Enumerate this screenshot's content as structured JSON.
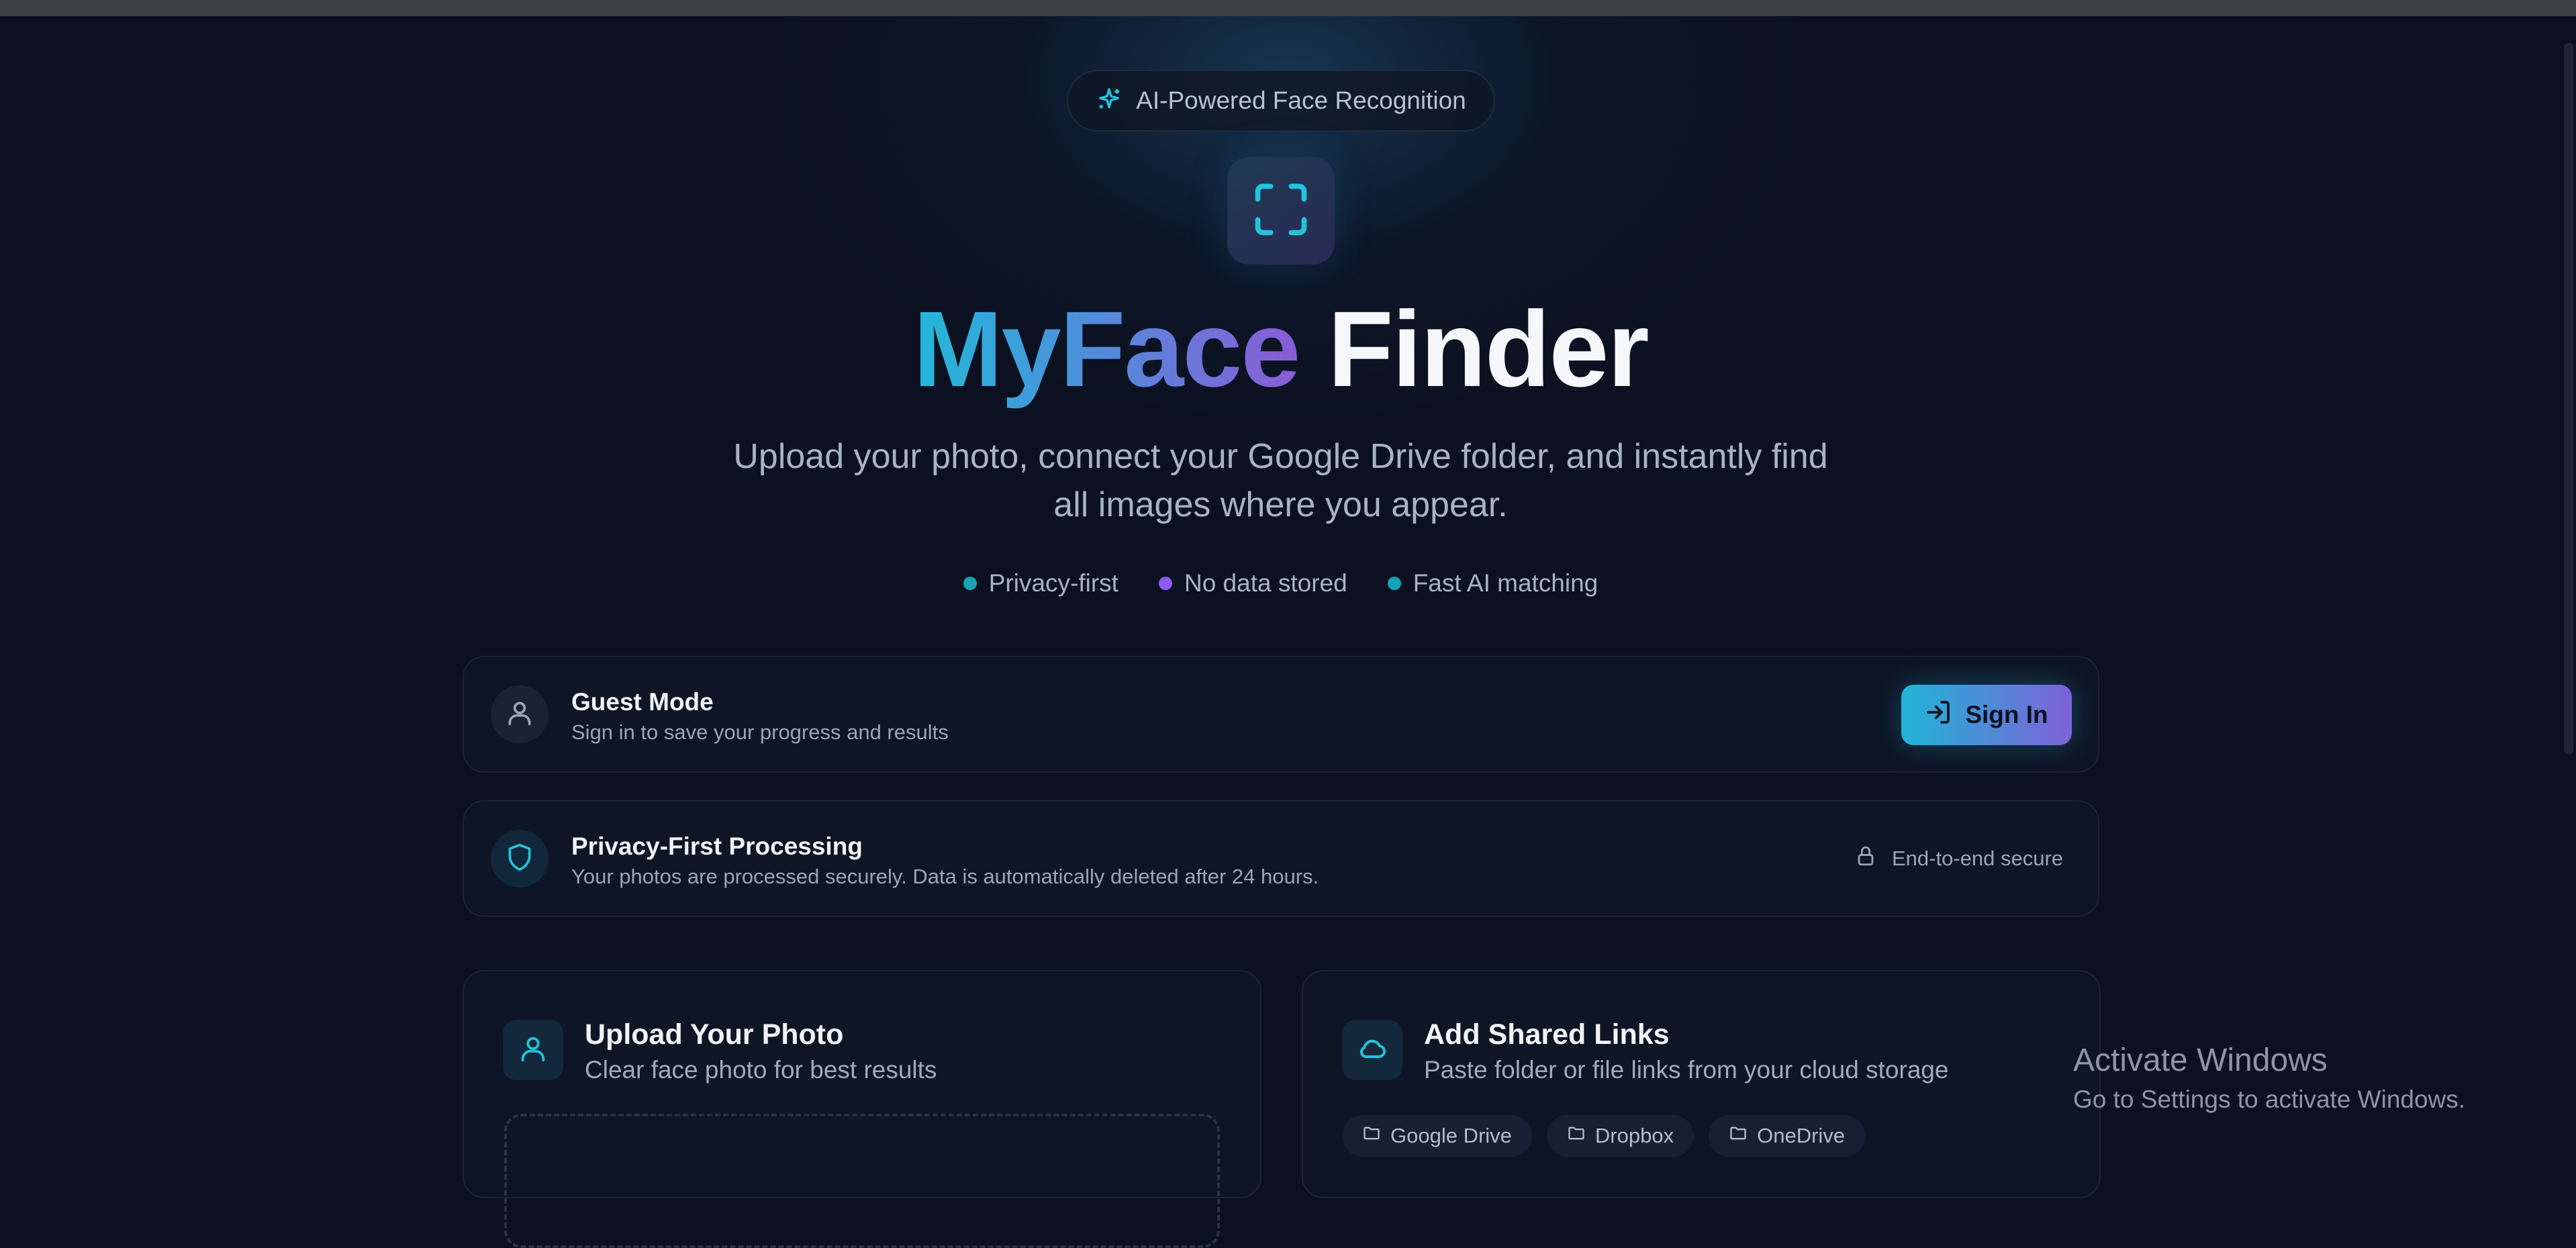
{
  "badge": {
    "label": "AI-Powered Face Recognition",
    "icon": "sparkles-icon"
  },
  "hero": {
    "logo_icon": "scan-frame-icon",
    "title_gradient": "MyFace",
    "title_plain": "Finder",
    "subtitle_line1": "Upload your photo, connect your Google Drive folder, and instantly find",
    "subtitle_line2": "all images where you appear."
  },
  "features": [
    {
      "label": "Privacy-first",
      "color": "#16a3b8"
    },
    {
      "label": "No data stored",
      "color": "#8b5cf6"
    },
    {
      "label": "Fast AI matching",
      "color": "#16a3b8"
    }
  ],
  "guest": {
    "icon": "user-icon",
    "title": "Guest Mode",
    "subtitle": "Sign in to save your progress and results",
    "signin_label": "Sign In",
    "signin_icon": "log-in-icon"
  },
  "privacy": {
    "icon": "shield-icon",
    "title": "Privacy-First Processing",
    "subtitle": "Your photos are processed securely. Data is automatically deleted after 24 hours.",
    "secure_label": "End-to-end secure",
    "secure_icon": "lock-icon"
  },
  "upload": {
    "icon": "user-icon",
    "title": "Upload Your Photo",
    "subtitle": "Clear face photo for best results"
  },
  "links": {
    "icon": "cloud-icon",
    "title": "Add Shared Links",
    "subtitle": "Paste folder or file links from your cloud storage",
    "chips": [
      "Google Drive",
      "Dropbox",
      "OneDrive"
    ]
  },
  "watermark": {
    "line1": "Activate Windows",
    "line2": "Go to Settings to activate Windows."
  },
  "colors": {
    "background": "#0b1120",
    "accent_cyan": "#22b8d8",
    "accent_purple": "#8a5bd6"
  }
}
